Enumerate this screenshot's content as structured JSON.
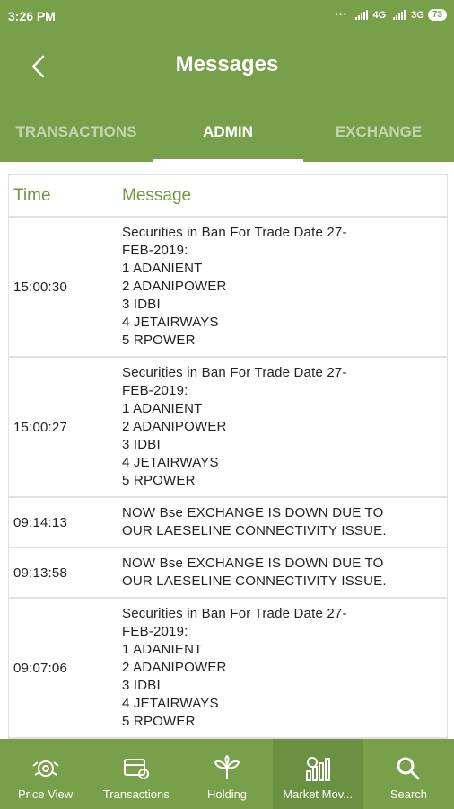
{
  "status_bar": {
    "time": "3:26 PM",
    "network1": "4G",
    "network2": "3G",
    "battery": "73"
  },
  "header": {
    "title": "Messages"
  },
  "tabs": [
    {
      "label": "TRANSACTIONS",
      "active": false
    },
    {
      "label": "ADMIN",
      "active": true
    },
    {
      "label": "EXCHANGE",
      "active": false
    }
  ],
  "table": {
    "headers": {
      "time": "Time",
      "message": "Message"
    },
    "rows": [
      {
        "time": "15:00:30",
        "message": "Securities in Ban For Trade Date 27-\nFEB-2019:\n1  ADANIENT\n2  ADANIPOWER\n3  IDBI\n4  JETAIRWAYS\n5  RPOWER"
      },
      {
        "time": "15:00:27",
        "message": "Securities in Ban For Trade Date 27-\nFEB-2019:\n1  ADANIENT\n2  ADANIPOWER\n3  IDBI\n4  JETAIRWAYS\n5  RPOWER"
      },
      {
        "time": "09:14:13",
        "message": "NOW Bse EXCHANGE IS DOWN DUE TO\nOUR LAESELINE CONNECTIVITY ISSUE."
      },
      {
        "time": "09:13:58",
        "message": "NOW Bse EXCHANGE IS DOWN DUE TO\nOUR LAESELINE CONNECTIVITY ISSUE."
      },
      {
        "time": "09:07:06",
        "message": "Securities in Ban For Trade Date 27-\nFEB-2019:\n1  ADANIENT\n2  ADANIPOWER\n3  IDBI\n4  JETAIRWAYS\n5  RPOWER"
      }
    ]
  },
  "bottom_nav": [
    {
      "label": "Price View",
      "icon": "price-view-icon"
    },
    {
      "label": "Transactions",
      "icon": "transactions-icon"
    },
    {
      "label": "Holding",
      "icon": "holding-icon"
    },
    {
      "label": "Market Mov...",
      "icon": "market-movers-icon",
      "active": true
    },
    {
      "label": "Search",
      "icon": "search-icon"
    }
  ],
  "colors": {
    "primary": "#78a04a",
    "header_text": "#6c9a3c",
    "grid": "#e1e1e1"
  }
}
